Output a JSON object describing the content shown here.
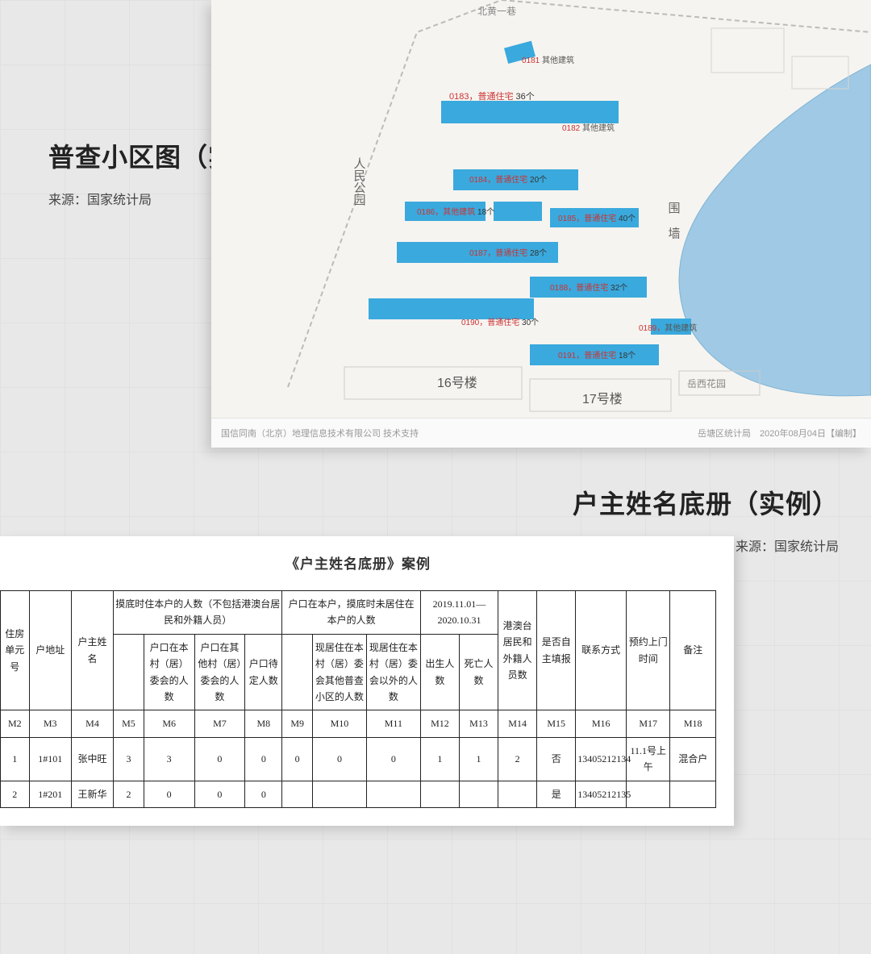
{
  "section1": {
    "title": "普查小区图（实例）",
    "source": "来源：国家统计局",
    "footer_left": "国信同南（北京）地理信息技术有限公司 技术支持",
    "footer_right": "岳塘区统计局　2020年08月04日【编制】"
  },
  "map": {
    "road_top": "北黄一巷",
    "park_label": "人民公园",
    "wall_label": "围 墙",
    "garden_label": "岳西花园",
    "b16": "16号楼",
    "b17": "17号楼",
    "buildings": [
      {
        "code": "0181",
        "type": "其他建筑",
        "count": ""
      },
      {
        "code": "0182",
        "type": "其他建筑",
        "count": ""
      },
      {
        "code": "0183",
        "type": "普通住宅",
        "count": "36个"
      },
      {
        "code": "0184",
        "type": "普通住宅",
        "count": "20个"
      },
      {
        "code": "0185",
        "type": "普通住宅",
        "count": "40个"
      },
      {
        "code": "0186",
        "type": "其他建筑",
        "count": "18个"
      },
      {
        "code": "0187",
        "type": "普通住宅",
        "count": "28个"
      },
      {
        "code": "0188",
        "type": "普通住宅",
        "count": "32个"
      },
      {
        "code": "0189",
        "type": "其他建筑",
        "count": ""
      },
      {
        "code": "0190",
        "type": "普通住宅",
        "count": "30个"
      },
      {
        "code": "0191",
        "type": "普通住宅",
        "count": "18个"
      }
    ]
  },
  "section2": {
    "title": "户主姓名底册（实例）",
    "source": "来源：国家统计局"
  },
  "form": {
    "doc_title": "《户主姓名底册》案例",
    "headers": {
      "g1": "摸底时住本户的人数（不包括港澳台居民和外籍人员）",
      "g2": "户口在本户，摸底时未居住在本户的人数",
      "g3": "2019.11.01—2020.10.31",
      "c1": "住房单元号",
      "c2": "户地址",
      "c3": "户主姓名",
      "c4a": "",
      "c4b": "户口在本村（居）委会的人数",
      "c4c": "户口在其他村（居）委会的人数",
      "c4d": "户口待定人数",
      "c5a": "",
      "c5b": "现居住在本村（居）委会其他普查小区的人数",
      "c5c": "现居住在本村（居）委会以外的人数",
      "c6a": "出生人数",
      "c6b": "死亡人数",
      "c7": "港澳台居民和外籍人员数",
      "c8": "是否自主填报",
      "c9": "联系方式",
      "c10": "预约上门时间",
      "c11": "备注"
    },
    "codes": [
      "M2",
      "M3",
      "M4",
      "M5",
      "M6",
      "M7",
      "M8",
      "M9",
      "M10",
      "M11",
      "M12",
      "M13",
      "M14",
      "M15",
      "M16",
      "M17",
      "M18"
    ],
    "rows": [
      {
        "m2": "1",
        "m3": "1#101",
        "m4": "张中旺",
        "m5": "3",
        "m6": "3",
        "m7": "0",
        "m8": "0",
        "m9": "0",
        "m10": "0",
        "m11": "0",
        "m12": "1",
        "m13": "1",
        "m14": "2",
        "m15": "否",
        "m16": "13405212134",
        "m17": "11.1号上午",
        "m18": "混合户"
      },
      {
        "m2": "2",
        "m3": "1#201",
        "m4": "王新华",
        "m5": "2",
        "m6": "0",
        "m7": "0",
        "m8": "0",
        "m9": "",
        "m10": "",
        "m11": "",
        "m12": "",
        "m13": "",
        "m14": "",
        "m15": "是",
        "m16": "13405212135",
        "m17": "",
        "m18": ""
      }
    ]
  }
}
